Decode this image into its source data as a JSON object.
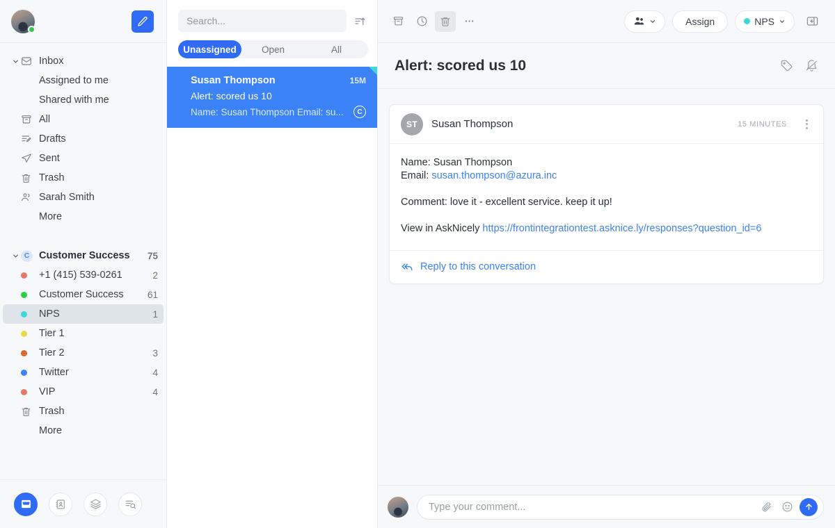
{
  "sidebar": {
    "user": {
      "avatar_name": "user-avatar",
      "status": "online"
    },
    "compose_label": "Compose",
    "inbox_group": [
      {
        "label": "Inbox",
        "icon": "inbox-icon",
        "count": "",
        "indent": 0,
        "chevron": true
      },
      {
        "label": "Assigned to me",
        "icon": "",
        "count": "",
        "indent": 1
      },
      {
        "label": "Shared with me",
        "icon": "",
        "count": "",
        "indent": 1
      },
      {
        "label": "All",
        "icon": "archive-icon",
        "count": "",
        "indent": 0
      },
      {
        "label": "Drafts",
        "icon": "drafts-icon",
        "count": "",
        "indent": 0
      },
      {
        "label": "Sent",
        "icon": "sent-icon",
        "count": "",
        "indent": 0
      },
      {
        "label": "Trash",
        "icon": "trash-icon",
        "count": "",
        "indent": 0
      },
      {
        "label": "Sarah Smith",
        "icon": "people-icon",
        "count": "",
        "indent": 0
      },
      {
        "label": "More",
        "icon": "",
        "count": "",
        "indent": 1
      }
    ],
    "team_group": {
      "label": "Customer Success",
      "badge": "C",
      "count": "75",
      "items": [
        {
          "label": "+1 (415) 539-0261",
          "count": "2",
          "dot": "#e8766a",
          "icon": "dot"
        },
        {
          "label": "Customer Success",
          "count": "61",
          "dot": "#2ecc4a",
          "icon": "dot"
        },
        {
          "label": "NPS",
          "count": "1",
          "dot": "#3fd8d8",
          "icon": "dot",
          "selected": true
        },
        {
          "label": "Tier 1",
          "count": "",
          "dot": "#e8d94a",
          "icon": "dot"
        },
        {
          "label": "Tier 2",
          "count": "3",
          "dot": "#e87a3a",
          "icon": "dot-pattern"
        },
        {
          "label": "Twitter",
          "count": "4",
          "dot": "#3b82f6",
          "icon": "dot"
        },
        {
          "label": "VIP",
          "count": "4",
          "dot": "#e8766a",
          "icon": "dot"
        },
        {
          "label": "Trash",
          "count": "",
          "dot": "",
          "icon": "trash-icon"
        },
        {
          "label": "More",
          "count": "",
          "dot": "",
          "icon": ""
        }
      ]
    },
    "bottom_tools": [
      {
        "name": "inbox-tool",
        "label": "Inbox",
        "active": true
      },
      {
        "name": "contacts-tool",
        "label": "Contacts",
        "active": false
      },
      {
        "name": "layers-tool",
        "label": "Library",
        "active": false
      },
      {
        "name": "analytics-tool",
        "label": "Analytics",
        "active": false
      }
    ]
  },
  "list": {
    "search": {
      "placeholder": "Search...",
      "value": ""
    },
    "sort_icon": "sort-ascending-icon",
    "tabs": [
      {
        "label": "Unassigned",
        "active": true
      },
      {
        "label": "Open",
        "active": false
      },
      {
        "label": "All",
        "active": false
      }
    ],
    "conversations": [
      {
        "name": "Susan Thompson",
        "time": "15M",
        "subject": "Alert: scored us 10",
        "preview": "Name: Susan Thompson Email: su...",
        "badge": "C",
        "selected": true,
        "corner_color": "#3fd8d8"
      }
    ]
  },
  "main": {
    "toolbar": {
      "left_icons": [
        {
          "name": "archive-icon",
          "label": "Archive",
          "hover": false
        },
        {
          "name": "snooze-clock-icon",
          "label": "Snooze",
          "hover": false
        },
        {
          "name": "trash-icon",
          "label": "Trash",
          "hover": true
        },
        {
          "name": "more-horizontal-icon",
          "label": "More",
          "hover": false
        }
      ],
      "assignee_label": "",
      "assign_label": "Assign",
      "inbox_label": "NPS",
      "inbox_dot": "#3fd8d8",
      "panel_toggle": "panel-toggle-icon"
    },
    "header": {
      "title": "Alert: scored us 10",
      "tag_icon": "tag-icon",
      "mute_icon": "bell-off-icon"
    },
    "message": {
      "avatar_initials": "ST",
      "sender": "Susan Thompson",
      "time": "15 MINUTES",
      "lines": [
        {
          "label": "Name: ",
          "value": "Susan Thompson",
          "link": ""
        },
        {
          "label": "Email: ",
          "value": "",
          "link": "susan.thompson@azura.inc"
        }
      ],
      "comment": "Comment: love it - excellent service. keep it up!",
      "view_label": "View in AskNicely ",
      "view_link": "https://frontintegrationtest.asknice.ly/responses?question_id=6",
      "reply_label": "Reply to this conversation"
    },
    "composer": {
      "placeholder": "Type your comment...",
      "value": "",
      "attach_icon": "paperclip-icon",
      "emoji_icon": "emoji-icon",
      "send_icon": "send-arrow-icon"
    }
  },
  "colors": {
    "accent": "#2f6bf4",
    "selected_conv": "#3b82f6",
    "teal": "#3fd8d8",
    "online": "#2ecc4a"
  }
}
